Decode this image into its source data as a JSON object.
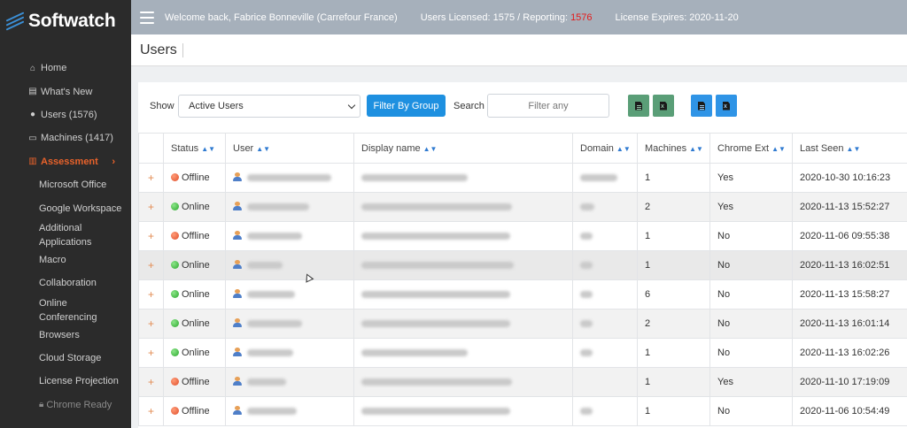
{
  "brand": {
    "logo_text": "Softwatch",
    "accent": "#e8622b"
  },
  "sidebar": {
    "items": [
      {
        "label": "Home",
        "icon": "home-icon"
      },
      {
        "label": "What's New",
        "icon": "newspaper-icon"
      },
      {
        "label": "Users (1576)",
        "icon": "users-icon"
      },
      {
        "label": "Machines (1417)",
        "icon": "monitor-icon"
      },
      {
        "label": "Assessment",
        "icon": "bar-chart-icon"
      }
    ],
    "sub_items": [
      "Microsoft Office",
      "Google Workspace",
      "Additional Applications",
      "Macro",
      "Collaboration",
      "Online Conferencing",
      "Browsers",
      "Cloud Storage",
      "License Projection",
      "Chrome Ready"
    ]
  },
  "header": {
    "welcome": "Welcome back, Fabrice Bonneville (Carrefour France)",
    "licensed_prefix": "Users Licensed: 1575 / Reporting: ",
    "reporting": "1576",
    "license_expires": "License Expires: 2020-11-20"
  },
  "page": {
    "title": "Users"
  },
  "filters": {
    "show_label": "Show",
    "show_value": "Active Users",
    "filter_button": "Filter By Group",
    "search_label": "Search",
    "search_placeholder": "Filter any"
  },
  "table": {
    "columns": [
      "Status",
      "User",
      "Display name",
      "Domain",
      "Machines",
      "Chrome Ext",
      "Last Seen"
    ],
    "rows": [
      {
        "status": "Offline",
        "machines": "1",
        "chrome": "Yes",
        "last_seen": "2020-10-30 10:16:23"
      },
      {
        "status": "Online",
        "machines": "2",
        "chrome": "Yes",
        "last_seen": "2020-11-13 15:52:27"
      },
      {
        "status": "Offline",
        "machines": "1",
        "chrome": "No",
        "last_seen": "2020-11-06 09:55:38"
      },
      {
        "status": "Online",
        "machines": "1",
        "chrome": "No",
        "last_seen": "2020-11-13 16:02:51"
      },
      {
        "status": "Online",
        "machines": "6",
        "chrome": "No",
        "last_seen": "2020-11-13 15:58:27"
      },
      {
        "status": "Online",
        "machines": "2",
        "chrome": "No",
        "last_seen": "2020-11-13 16:01:14"
      },
      {
        "status": "Online",
        "machines": "1",
        "chrome": "No",
        "last_seen": "2020-11-13 16:02:26"
      },
      {
        "status": "Offline",
        "machines": "1",
        "chrome": "Yes",
        "last_seen": "2020-11-10 17:19:09"
      },
      {
        "status": "Offline",
        "machines": "1",
        "chrome": "No",
        "last_seen": "2020-11-06 10:54:49"
      }
    ]
  },
  "colors": {
    "online": "#2aa82c",
    "offline": "#e04d2a",
    "primary": "#1e90e0",
    "header_bg": "#a6b0bb"
  }
}
